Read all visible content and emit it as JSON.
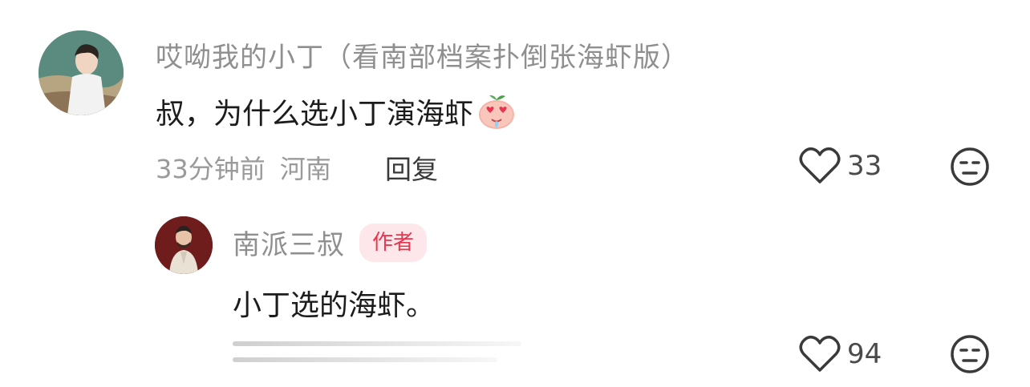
{
  "comment": {
    "username": "哎呦我的小丁（看南部档案扑倒张海虾版）",
    "text": "叔，为什么选小丁演海虾",
    "emoji": "heart-eyes-peach-emoji",
    "time": "33分钟前",
    "location": "河南",
    "reply_label": "回复",
    "likes": "33"
  },
  "reply": {
    "username": "南派三叔",
    "badge": "作者",
    "text": "小丁选的海虾。",
    "likes": "94"
  },
  "colors": {
    "username": "#8f8f8f",
    "badge_bg": "#fde7ea",
    "badge_text": "#e8364f"
  }
}
